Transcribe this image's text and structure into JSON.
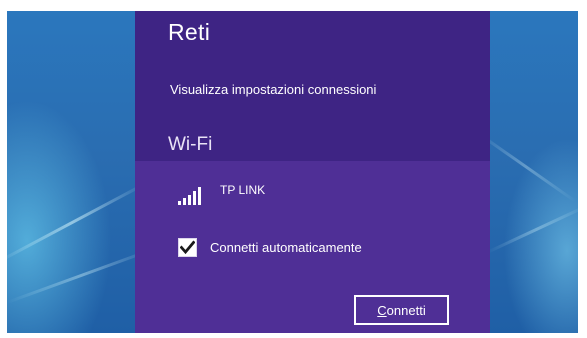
{
  "panel": {
    "title": "Reti",
    "connections_link": "Visualizza impostazioni connessioni",
    "section_title": "Wi-Fi",
    "accent_color": "#4a2d8f"
  },
  "network": {
    "name": "TP LINK",
    "signal_icon": "wifi-signal-bars-icon",
    "signal_bars_filled": 5
  },
  "auto_connect": {
    "label": "Connetti automaticamente",
    "checked": true
  },
  "actions": {
    "connect_label": "Connetti"
  }
}
